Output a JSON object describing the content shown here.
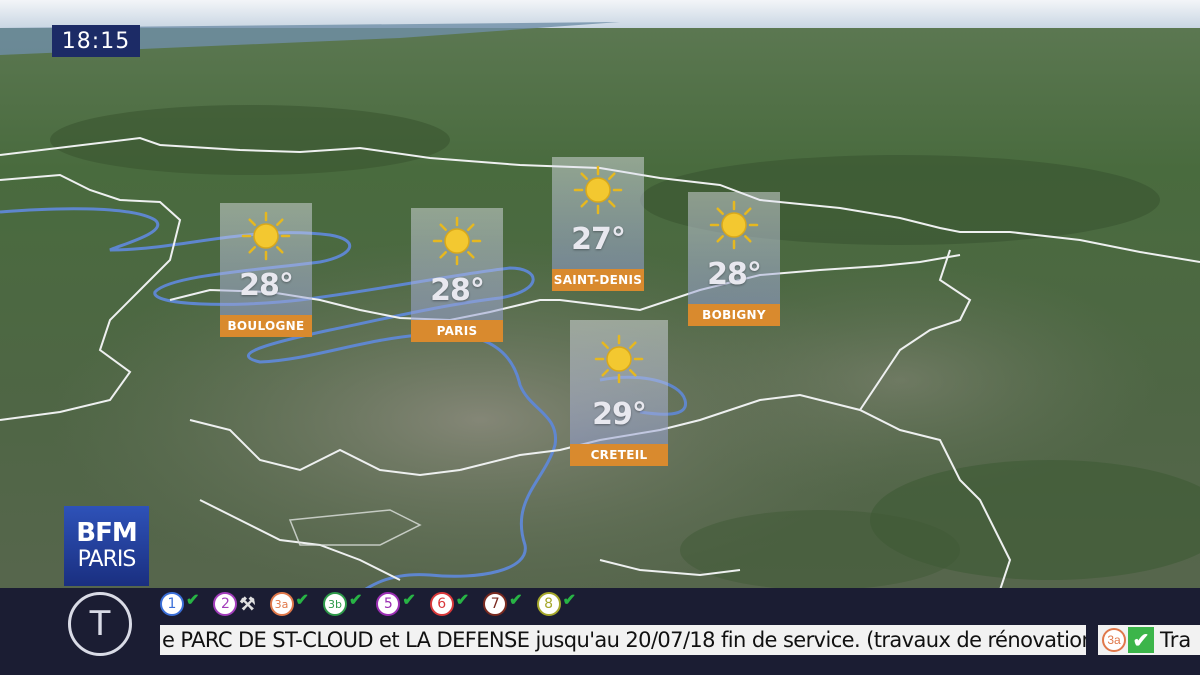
{
  "clock": {
    "time": "18:15"
  },
  "forecasts": [
    {
      "city": "BOULOGNE",
      "temp": "28°",
      "icon": "sun-icon"
    },
    {
      "city": "PARIS",
      "temp": "28°",
      "icon": "sun-icon"
    },
    {
      "city": "SAINT-DENIS",
      "temp": "27°",
      "icon": "sun-icon"
    },
    {
      "city": "BOBIGNY",
      "temp": "28°",
      "icon": "sun-icon"
    },
    {
      "city": "CRETEIL",
      "temp": "29°",
      "icon": "sun-icon"
    }
  ],
  "logo": {
    "line1": "BFM",
    "line2": "PARIS"
  },
  "ticker": {
    "transport_icon": "T",
    "lines": [
      {
        "number": "1",
        "color": "#3b6fd8"
      },
      {
        "number": "2",
        "color": "#a23dbb"
      },
      {
        "number": "3a",
        "color": "#e0784a"
      },
      {
        "number": "3b",
        "color": "#2e9a4a"
      },
      {
        "number": "5",
        "color": "#9b2fb3"
      },
      {
        "number": "6",
        "color": "#d9383a"
      },
      {
        "number": "7",
        "color": "#7a2a20"
      },
      {
        "number": "8",
        "color": "#a5a72a"
      }
    ],
    "message": "e PARC DE ST-CLOUD et LA DEFENSE jusqu'au 20/07/18 fin de service. (travaux de rénovation)",
    "next_line": "3a",
    "next_text": "Tra"
  },
  "colors": {
    "city_banner": "#d98a2e",
    "ticker_bg": "#1b1d33",
    "clock_bg": "#1c2b66",
    "ok_check": "#28b445"
  }
}
